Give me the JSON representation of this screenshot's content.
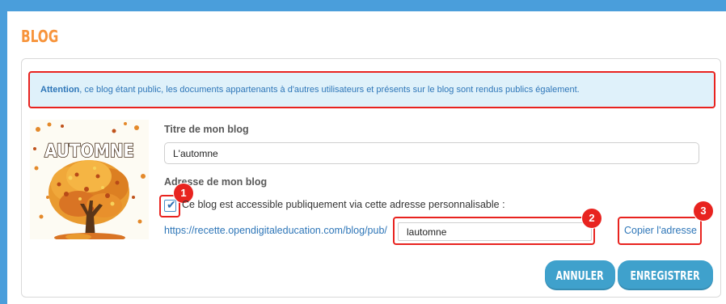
{
  "page": {
    "title": "BLOG"
  },
  "alert": {
    "strong": "Attention",
    "text": ", ce blog étant public, les documents appartenants à d'autres utilisateurs et présents sur le blog sont rendus publics également."
  },
  "thumbnail": {
    "text": "AUTOMNE",
    "icon": "autumn-tree-illustration"
  },
  "form": {
    "title_label": "Titre de mon blog",
    "title_value": "L'automne",
    "address_label": "Adresse de mon blog",
    "public_checkbox_label": "Ce blog est accessible publiquement via cette adresse personnalisable :",
    "public_checked": true,
    "url_prefix": "https://recette.opendigitaleducation.com/blog/pub/",
    "slug_value": "lautomne",
    "copy_link": "Copier l'adresse"
  },
  "badges": {
    "one": "1",
    "two": "2",
    "three": "3"
  },
  "buttons": {
    "cancel": "ANNULER",
    "save": "ENREGISTRER"
  },
  "colors": {
    "accent": "#f7943c",
    "primary": "#3fa1cc",
    "highlight": "#e8231f",
    "link": "#2e76b8",
    "alert_bg": "#dff1fa"
  }
}
